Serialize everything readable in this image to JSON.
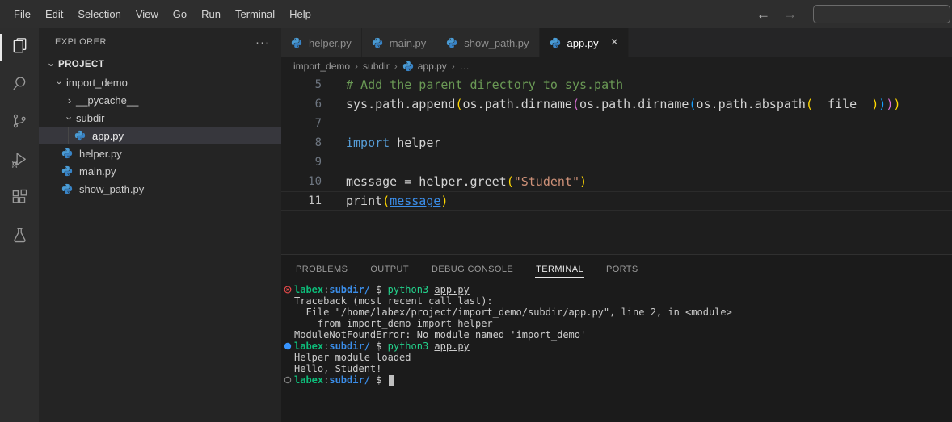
{
  "menu_bar": {
    "items": [
      "File",
      "Edit",
      "Selection",
      "View",
      "Go",
      "Run",
      "Terminal",
      "Help"
    ],
    "back_icon": "←",
    "forward_icon": "→",
    "search_value": "",
    "search_placeholder": ""
  },
  "activity_bar": {
    "items": [
      {
        "name": "explorer",
        "active": true
      },
      {
        "name": "search",
        "active": false
      },
      {
        "name": "source-control",
        "active": false
      },
      {
        "name": "run-debug",
        "active": false
      },
      {
        "name": "extensions",
        "active": false
      },
      {
        "name": "testing",
        "active": false
      }
    ]
  },
  "sidebar": {
    "title": "EXPLORER",
    "more_label": "···",
    "tree": [
      {
        "label": "PROJECT",
        "type": "section",
        "depth": 0,
        "expanded": true
      },
      {
        "label": "import_demo",
        "type": "folder",
        "depth": 1,
        "expanded": true
      },
      {
        "label": "__pycache__",
        "type": "folder",
        "depth": 2,
        "expanded": false
      },
      {
        "label": "subdir",
        "type": "folder",
        "depth": 2,
        "expanded": true
      },
      {
        "label": "app.py",
        "type": "file",
        "depth": 3,
        "icon": "python",
        "selected": true
      },
      {
        "label": "helper.py",
        "type": "file",
        "depth": 2,
        "icon": "python",
        "selected": false
      },
      {
        "label": "main.py",
        "type": "file",
        "depth": 2,
        "icon": "python",
        "selected": false
      },
      {
        "label": "show_path.py",
        "type": "file",
        "depth": 2,
        "icon": "python",
        "selected": false
      }
    ]
  },
  "editor": {
    "tabs": [
      {
        "label": "helper.py",
        "icon": "python",
        "active": false
      },
      {
        "label": "main.py",
        "icon": "python",
        "active": false
      },
      {
        "label": "show_path.py",
        "icon": "python",
        "active": false
      },
      {
        "label": "app.py",
        "icon": "python",
        "active": true,
        "close_icon": "×"
      }
    ],
    "breadcrumbs": [
      {
        "label": "import_demo"
      },
      {
        "label": "subdir"
      },
      {
        "label": "app.py",
        "icon": "python"
      },
      {
        "label": "…"
      }
    ],
    "code_lines": [
      {
        "num": "5",
        "active": false,
        "tokens": [
          {
            "t": "# Add the parent directory to sys.path",
            "c": "comment"
          }
        ]
      },
      {
        "num": "6",
        "active": false,
        "tokens": [
          {
            "t": "sys.path.append",
            "c": "plain"
          },
          {
            "t": "(",
            "c": "p1"
          },
          {
            "t": "os.path.dirname",
            "c": "plain"
          },
          {
            "t": "(",
            "c": "p2"
          },
          {
            "t": "os.path.dirname",
            "c": "plain"
          },
          {
            "t": "(",
            "c": "p3"
          },
          {
            "t": "os.path.abspath",
            "c": "plain"
          },
          {
            "t": "(",
            "c": "p1"
          },
          {
            "t": "__file__",
            "c": "plain"
          },
          {
            "t": ")",
            "c": "p1"
          },
          {
            "t": ")",
            "c": "p3"
          },
          {
            "t": ")",
            "c": "p2"
          },
          {
            "t": ")",
            "c": "p1"
          }
        ]
      },
      {
        "num": "7",
        "active": false,
        "tokens": []
      },
      {
        "num": "8",
        "active": false,
        "tokens": [
          {
            "t": "import",
            "c": "kw"
          },
          {
            "t": " helper",
            "c": "plain"
          }
        ]
      },
      {
        "num": "9",
        "active": false,
        "tokens": []
      },
      {
        "num": "10",
        "active": false,
        "tokens": [
          {
            "t": "message = helper.greet",
            "c": "plain"
          },
          {
            "t": "(",
            "c": "p1"
          },
          {
            "t": "\"Student\"",
            "c": "str"
          },
          {
            "t": ")",
            "c": "p1"
          }
        ]
      },
      {
        "num": "11",
        "active": true,
        "tokens": [
          {
            "t": "print",
            "c": "plain"
          },
          {
            "t": "(",
            "c": "p1"
          },
          {
            "t": "message",
            "c": "link"
          },
          {
            "t": ")",
            "c": "p1"
          }
        ]
      }
    ]
  },
  "panel": {
    "tabs": [
      {
        "label": "PROBLEMS",
        "active": false
      },
      {
        "label": "OUTPUT",
        "active": false
      },
      {
        "label": "DEBUG CONSOLE",
        "active": false
      },
      {
        "label": "TERMINAL",
        "active": true
      },
      {
        "label": "PORTS",
        "active": false
      }
    ],
    "terminal_lines": [
      {
        "icon": "error",
        "cursor": false,
        "segments": [
          {
            "t": "labex",
            "c": "g"
          },
          {
            "t": ":",
            "c": "w"
          },
          {
            "t": "subdir/",
            "c": "b"
          },
          {
            "t": " $ ",
            "c": "w"
          },
          {
            "t": "python3 ",
            "c": "gc"
          },
          {
            "t": "app.py",
            "c": "wu"
          }
        ]
      },
      {
        "icon": null,
        "cursor": false,
        "segments": [
          {
            "t": "Traceback (most recent call last):",
            "c": "w"
          }
        ]
      },
      {
        "icon": null,
        "cursor": false,
        "segments": [
          {
            "t": "  File \"/home/labex/project/import_demo/subdir/app.py\", line 2, in <module>",
            "c": "w"
          }
        ]
      },
      {
        "icon": null,
        "cursor": false,
        "segments": [
          {
            "t": "    from import_demo import helper",
            "c": "w"
          }
        ]
      },
      {
        "icon": null,
        "cursor": false,
        "segments": [
          {
            "t": "ModuleNotFoundError: No module named 'import_demo'",
            "c": "w"
          }
        ]
      },
      {
        "icon": "success",
        "cursor": false,
        "segments": [
          {
            "t": "labex",
            "c": "g"
          },
          {
            "t": ":",
            "c": "w"
          },
          {
            "t": "subdir/",
            "c": "b"
          },
          {
            "t": " $ ",
            "c": "w"
          },
          {
            "t": "python3 ",
            "c": "gc"
          },
          {
            "t": "app.py",
            "c": "wu"
          }
        ]
      },
      {
        "icon": null,
        "cursor": false,
        "segments": [
          {
            "t": "Helper module loaded",
            "c": "w"
          }
        ]
      },
      {
        "icon": null,
        "cursor": false,
        "segments": [
          {
            "t": "Hello, Student!",
            "c": "w"
          }
        ]
      },
      {
        "icon": "pending",
        "cursor": true,
        "segments": [
          {
            "t": "labex",
            "c": "g"
          },
          {
            "t": ":",
            "c": "w"
          },
          {
            "t": "subdir/",
            "c": "b"
          },
          {
            "t": " $ ",
            "c": "w"
          }
        ]
      }
    ]
  },
  "colors": {
    "error_red": "#f14c4c",
    "success_blue": "#3794ff",
    "prompt_green": "#0dbc79",
    "prompt_blue": "#3b8eea",
    "bracket_gold": "#ffd700",
    "bracket_orchid": "#da70d6",
    "bracket_blue": "#179fff"
  }
}
